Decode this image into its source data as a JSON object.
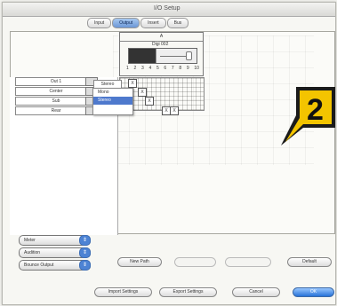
{
  "window": {
    "title": "I/O Setup"
  },
  "tabs": [
    {
      "label": "Input",
      "active": false
    },
    {
      "label": "Output",
      "active": true
    },
    {
      "label": "Insert",
      "active": false
    },
    {
      "label": "Bus",
      "active": false
    }
  ],
  "io_header": {
    "top_label": "A",
    "bus_name": "Digi 002",
    "channels": [
      "1",
      "2",
      "3",
      "4",
      "5",
      "6",
      "7",
      "8",
      "9",
      "10"
    ]
  },
  "rows": [
    {
      "name": "Out 1"
    },
    {
      "name": "Center"
    },
    {
      "name": "Sub"
    },
    {
      "name": "Rear"
    }
  ],
  "row_dropdown": {
    "current": "Stereo",
    "options": [
      "Mono",
      "Stereo"
    ]
  },
  "callout": {
    "number": "2"
  },
  "bottom_selects": [
    {
      "label": "Meter"
    },
    {
      "label": "Audition"
    },
    {
      "label": "Bounce Output"
    }
  ],
  "buttons": {
    "new_path": "New Path",
    "import": "Import Settings",
    "export": "Export Settings",
    "cancel": "Cancel",
    "ok": "OK",
    "default": "Default"
  }
}
